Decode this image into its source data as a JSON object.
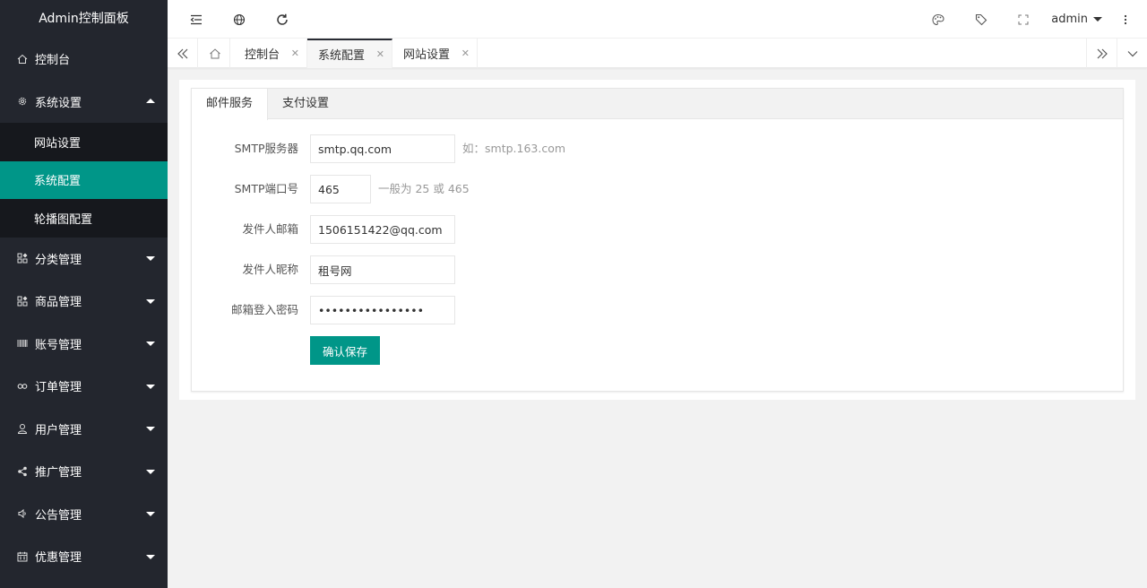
{
  "sidebar": {
    "logo": "Admin控制面板",
    "items": [
      {
        "label": "控制台",
        "icon": "home-icon"
      },
      {
        "label": "系统设置",
        "icon": "gear-icon",
        "expanded": true,
        "children": [
          {
            "label": "网站设置",
            "active": false
          },
          {
            "label": "系统配置",
            "active": true
          },
          {
            "label": "轮播图配置",
            "active": false
          }
        ]
      },
      {
        "label": "分类管理",
        "icon": "apps-icon"
      },
      {
        "label": "商品管理",
        "icon": "apps-icon"
      },
      {
        "label": "账号管理",
        "icon": "barcode-icon"
      },
      {
        "label": "订单管理",
        "icon": "link-icon"
      },
      {
        "label": "用户管理",
        "icon": "user-icon"
      },
      {
        "label": "推广管理",
        "icon": "share-icon"
      },
      {
        "label": "公告管理",
        "icon": "speaker-icon"
      },
      {
        "label": "优惠管理",
        "icon": "calendar-icon"
      }
    ]
  },
  "header": {
    "user": "admin",
    "icons": [
      "shrink-menu-icon",
      "globe-icon",
      "refresh-icon",
      "theme-icon",
      "tag-icon",
      "fullscreen-icon",
      "more-icon"
    ]
  },
  "tabs": [
    {
      "label": "控制台",
      "active": false
    },
    {
      "label": "系统配置",
      "active": true
    },
    {
      "label": "网站设置",
      "active": false
    }
  ],
  "card": {
    "tabs": [
      {
        "label": "邮件服务",
        "active": true
      },
      {
        "label": "支付设置",
        "active": false
      }
    ],
    "form": {
      "smtp_server": {
        "label": "SMTP服务器",
        "value": "smtp.qq.com",
        "tip": "如：smtp.163.com"
      },
      "smtp_port": {
        "label": "SMTP端口号",
        "value": "465",
        "tip": "一般为 25 或 465"
      },
      "sender_email": {
        "label": "发件人邮箱",
        "value": "1506151422@qq.com"
      },
      "sender_name": {
        "label": "发件人昵称",
        "value": "租号网"
      },
      "password": {
        "label": "邮箱登入密码",
        "value": "••••••••••••••••"
      },
      "submit_label": "确认保存"
    }
  },
  "colors": {
    "sidebar_bg": "#23262e",
    "submenu_bg": "#16181d",
    "accent": "#009688"
  }
}
